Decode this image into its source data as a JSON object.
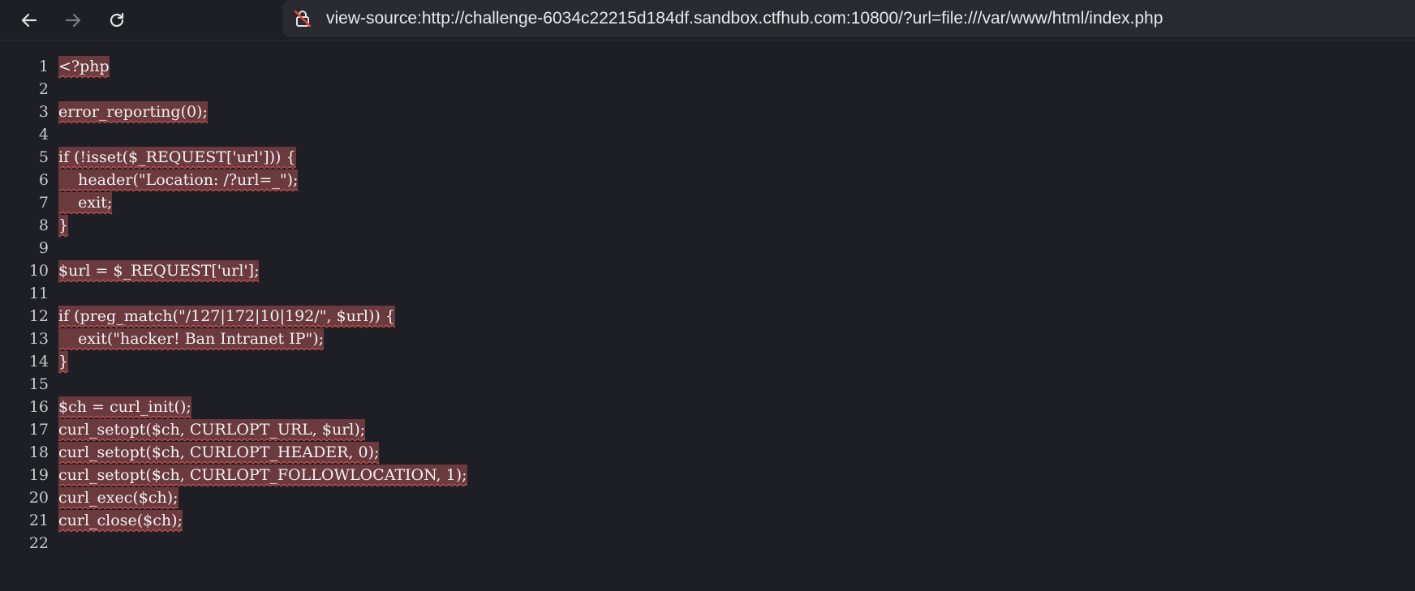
{
  "browser": {
    "url": "view-source:http://challenge-6034c22215d184df.sandbox.ctfhub.com:10800/?url=file:///var/www/html/index.php",
    "icons": {
      "back": "arrow-left-icon",
      "forward": "arrow-right-icon",
      "reload": "reload-icon",
      "site": "not-secure-icon"
    }
  },
  "source": {
    "lines": [
      {
        "num": "1",
        "text": "<?php"
      },
      {
        "num": "2",
        "text": ""
      },
      {
        "num": "3",
        "text": "error_reporting(0);"
      },
      {
        "num": "4",
        "text": ""
      },
      {
        "num": "5",
        "text": "if (!isset($_REQUEST['url'])) {"
      },
      {
        "num": "6",
        "text": "    header(\"Location: /?url=_\");"
      },
      {
        "num": "7",
        "text": "    exit;"
      },
      {
        "num": "8",
        "text": "}"
      },
      {
        "num": "9",
        "text": ""
      },
      {
        "num": "10",
        "text": "$url = $_REQUEST['url'];"
      },
      {
        "num": "11",
        "text": ""
      },
      {
        "num": "12",
        "text": "if (preg_match(\"/127|172|10|192/\", $url)) {"
      },
      {
        "num": "13",
        "text": "    exit(\"hacker! Ban Intranet IP\");"
      },
      {
        "num": "14",
        "text": "}"
      },
      {
        "num": "15",
        "text": ""
      },
      {
        "num": "16",
        "text": "$ch = curl_init();"
      },
      {
        "num": "17",
        "text": "curl_setopt($ch, CURLOPT_URL, $url);"
      },
      {
        "num": "18",
        "text": "curl_setopt($ch, CURLOPT_HEADER, 0);"
      },
      {
        "num": "19",
        "text": "curl_setopt($ch, CURLOPT_FOLLOWLOCATION, 1);"
      },
      {
        "num": "20",
        "text": "curl_exec($ch);"
      },
      {
        "num": "21",
        "text": "curl_close($ch);"
      },
      {
        "num": "22",
        "text": ""
      }
    ]
  },
  "colors": {
    "background": "#1e1f24",
    "highlight": "#6b3a3f",
    "squiggle": "#d9534f"
  }
}
